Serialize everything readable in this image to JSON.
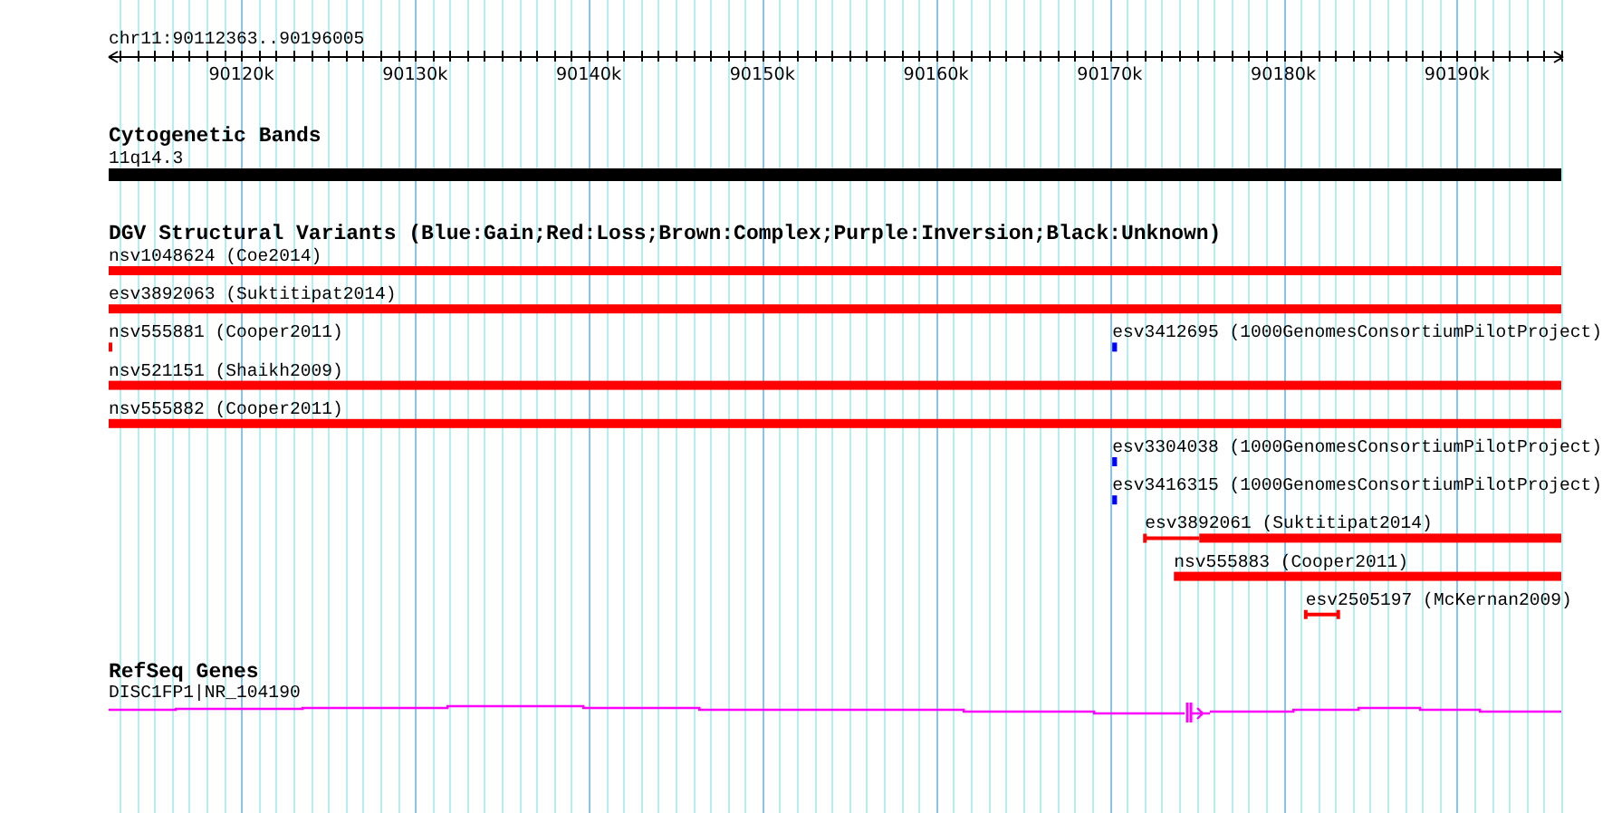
{
  "ruler": {
    "location": "chr11:90112363..90196005",
    "tick_labels": [
      "90120k",
      "90130k",
      "90140k",
      "90150k",
      "90160k",
      "90170k",
      "90180k",
      "90190k"
    ]
  },
  "cytoband": {
    "title": "Cytogenetic Bands",
    "band": "11q14.3"
  },
  "dgv": {
    "title": "DGV Structural Variants (Blue:Gain;Red:Loss;Brown:Complex;Purple:Inversion;Black:Unknown)",
    "rows": [
      {
        "features": [
          {
            "label": "nsv1048624 (Coe2014)",
            "kind": "bar",
            "color": "#ff0000"
          }
        ]
      },
      {
        "features": [
          {
            "label": "esv3892063 (Suktitipat2014)",
            "kind": "bar",
            "color": "#ff0000"
          }
        ]
      },
      {
        "features": [
          {
            "label": "nsv555881 (Cooper2011)",
            "kind": "bar",
            "color": "#ff0000"
          },
          {
            "label": "esv3412695 (1000GenomesConsortiumPilotProject)",
            "kind": "bar",
            "color": "#0000ff"
          }
        ]
      },
      {
        "features": [
          {
            "label": "nsv521151 (Shaikh2009)",
            "kind": "bar",
            "color": "#ff0000"
          }
        ]
      },
      {
        "features": [
          {
            "label": "nsv555882 (Cooper2011)",
            "kind": "bar",
            "color": "#ff0000"
          }
        ]
      },
      {
        "features": [
          {
            "label": "esv3304038 (1000GenomesConsortiumPilotProject)",
            "kind": "bar",
            "color": "#0000ff"
          }
        ]
      },
      {
        "features": [
          {
            "label": "esv3416315 (1000GenomesConsortiumPilotProject)",
            "kind": "bar",
            "color": "#0000ff"
          }
        ]
      },
      {
        "features": [
          {
            "label": "esv3892061 (Suktitipat2014)",
            "kind": "split",
            "color": "#ff0000"
          }
        ]
      },
      {
        "features": [
          {
            "label": "nsv555883 (Cooper2011)",
            "kind": "bar",
            "color": "#ff0000"
          }
        ]
      },
      {
        "features": [
          {
            "label": "esv2505197 (McKernan2009)",
            "kind": "capped",
            "color": "#ff0000"
          }
        ]
      }
    ]
  },
  "genes": {
    "title": "RefSeq Genes",
    "label": "DISC1FP1|NR_104190"
  }
}
